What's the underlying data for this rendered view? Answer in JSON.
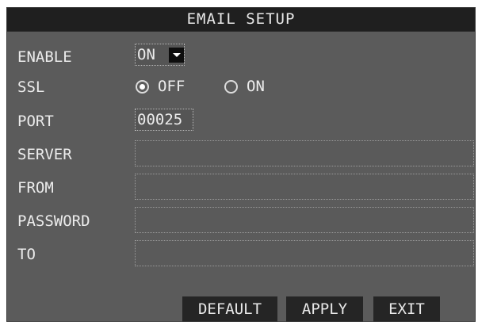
{
  "window": {
    "title": "EMAIL SETUP"
  },
  "fields": {
    "enable": {
      "label": "ENABLE",
      "value": "ON"
    },
    "ssl": {
      "label": "SSL",
      "options": [
        "OFF",
        "ON"
      ],
      "selected": "OFF"
    },
    "port": {
      "label": "PORT",
      "value": "00025"
    },
    "server": {
      "label": "SERVER",
      "value": ""
    },
    "from": {
      "label": "FROM",
      "value": ""
    },
    "password": {
      "label": "PASSWORD",
      "value": ""
    },
    "to": {
      "label": "TO",
      "value": ""
    }
  },
  "buttons": {
    "default": "DEFAULT",
    "apply": "APPLY",
    "exit": "EXIT"
  },
  "colors": {
    "panel": "#5b5b5b",
    "titlebar": "#1f1f1f",
    "button": "#252525",
    "text": "#ececec"
  }
}
